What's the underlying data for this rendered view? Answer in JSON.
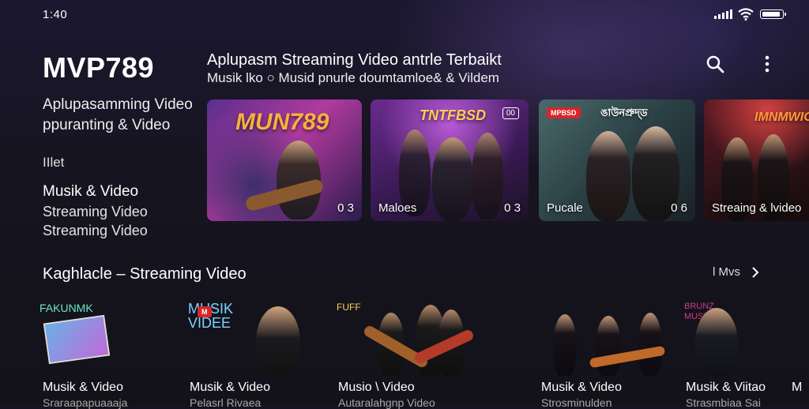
{
  "status": {
    "time": "1:40",
    "battery_level": 0.9
  },
  "sidebar": {
    "brand": "MVP789",
    "subtitle": "Aplupasamming Video ppuranting & Video",
    "heading": "IIlet",
    "items": [
      {
        "label": "Musik & Video"
      },
      {
        "label": "Streaming Video"
      },
      {
        "label": "Streaming Video"
      }
    ]
  },
  "hero": {
    "title": "Aplupasm  Streaming Video antrle  Terbaikt",
    "subtitle": "Musik lko  ○  Musid pnurle doumtamloe& & Vildem",
    "search_icon": "search-icon",
    "menu_icon": "more-vertical-icon",
    "cards": [
      {
        "logo": "MUN789",
        "caption": "",
        "count": "0 3"
      },
      {
        "logo": "TNTFBSD",
        "caption": "Maloes",
        "count": "0 3"
      },
      {
        "logo": "ঙাউনপ্ৰুদ্ড",
        "caption": "Pucale",
        "count": "0 6"
      },
      {
        "logo": "IMNMWIO",
        "caption": "Streaing & lvideo",
        "count": ""
      }
    ]
  },
  "section": {
    "title": "Kaghlacle – Streaming Video",
    "see_all": "l  Mvs",
    "tiles": [
      {
        "title": "Musik & Video",
        "sub": "Sraraapapuaaaja",
        "art": "FAKUNMK"
      },
      {
        "title": "Musik & Video",
        "sub": "Pelasrl Rivaea",
        "art": "MUSIK VIDEE"
      },
      {
        "title": "Musio \\ Video",
        "sub": "Autaralahgnp Video",
        "art": ""
      },
      {
        "title": "Musik & Video",
        "sub": "Strosminulden",
        "art": ""
      },
      {
        "title": "Musik & Viitao",
        "sub": "Strasmbiaa Sai",
        "art": "BRUNZ MUSKIC"
      },
      {
        "title": "M",
        "sub": "",
        "art": ""
      }
    ]
  }
}
